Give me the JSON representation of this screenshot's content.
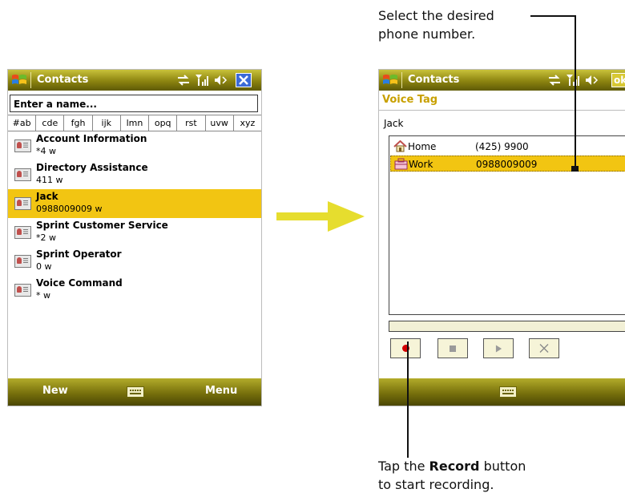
{
  "left_screen": {
    "title": "Contacts",
    "search_placeholder": "Enter a name...",
    "letter_groups": [
      "#ab",
      "cde",
      "fgh",
      "ijk",
      "lmn",
      "opq",
      "rst",
      "uvw",
      "xyz"
    ],
    "contacts": [
      {
        "name": "Account Information",
        "number": "*4   w"
      },
      {
        "name": "Directory Assistance",
        "number": "411   w"
      },
      {
        "name": "Jack",
        "number": "0988009009   w"
      },
      {
        "name": "Sprint Customer Service",
        "number": "*2   w"
      },
      {
        "name": "Sprint Operator",
        "number": "0   w"
      },
      {
        "name": "Voice Command",
        "number": "*   w"
      }
    ],
    "left_softkey": "New",
    "right_softkey": "Menu"
  },
  "right_screen": {
    "title": "Contacts",
    "ok_label": "ok",
    "section_title": "Voice Tag",
    "contact_name": "Jack",
    "numbers": [
      {
        "label": "Home",
        "value": "(425) 9900",
        "icon": "home-icon"
      },
      {
        "label": "Work",
        "value": "0988009009",
        "icon": "work-icon"
      }
    ]
  },
  "annotations": {
    "top_line1": "Select the desired",
    "top_line2": "phone number.",
    "bottom_pre": "Tap the ",
    "bottom_bold": "Record",
    "bottom_post": " button",
    "bottom_line2": "to start recording."
  },
  "colors": {
    "selection": "#f2c512",
    "titlebar": "#8c8410",
    "arrow": "#e6dd2e",
    "voice_tag": "#c8a000",
    "record_dot": "#d40000"
  }
}
